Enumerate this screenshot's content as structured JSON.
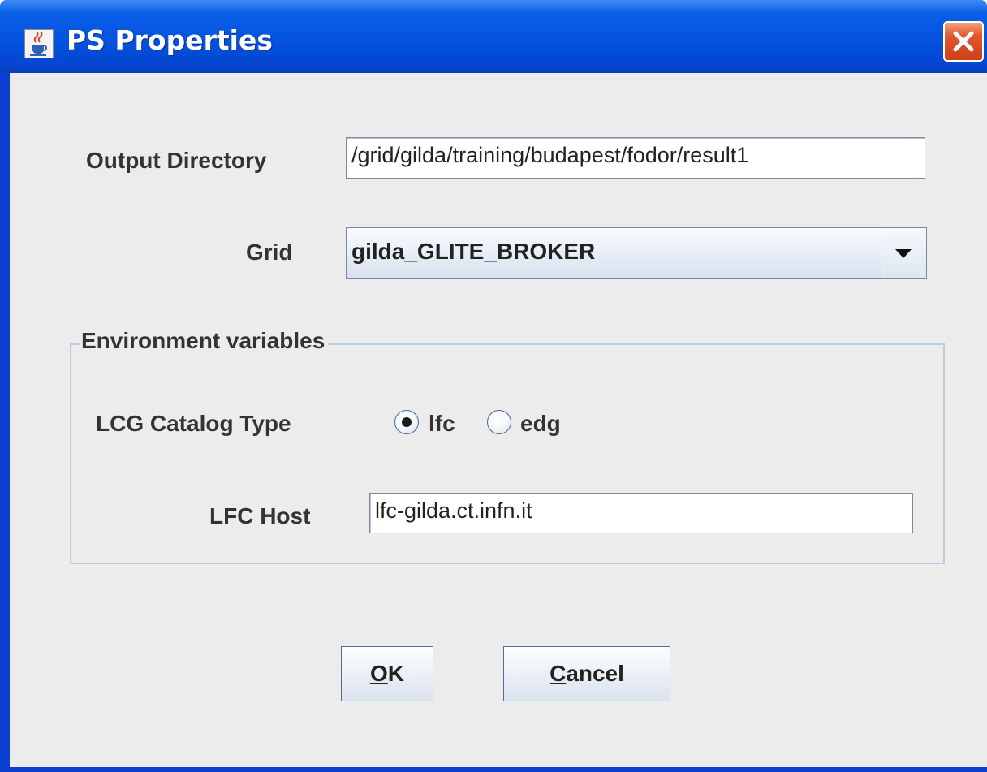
{
  "window": {
    "title": "PS Properties",
    "icon": "java-cup-icon",
    "close_icon": "close-icon"
  },
  "form": {
    "output_directory_label": "Output Directory",
    "output_directory_value": "/grid/gilda/training/budapest/fodor/result1",
    "grid_label": "Grid",
    "grid_value": "gilda_GLITE_BROKER",
    "environment_group_title": "Environment variables",
    "catalog_type_label": "LCG Catalog Type",
    "catalog_options": [
      {
        "label": "lfc",
        "selected": true
      },
      {
        "label": "edg",
        "selected": false
      }
    ],
    "lfc_host_label": "LFC Host",
    "lfc_host_value": "lfc-gilda.ct.infn.it"
  },
  "buttons": {
    "ok_mnemonic": "O",
    "ok_rest": "K",
    "cancel_mnemonic": "C",
    "cancel_rest": "ancel"
  },
  "colors": {
    "titlebar": "#0553de",
    "client_background": "#ececec",
    "group_border": "#b9cde2",
    "close_button": "#e2582e"
  }
}
